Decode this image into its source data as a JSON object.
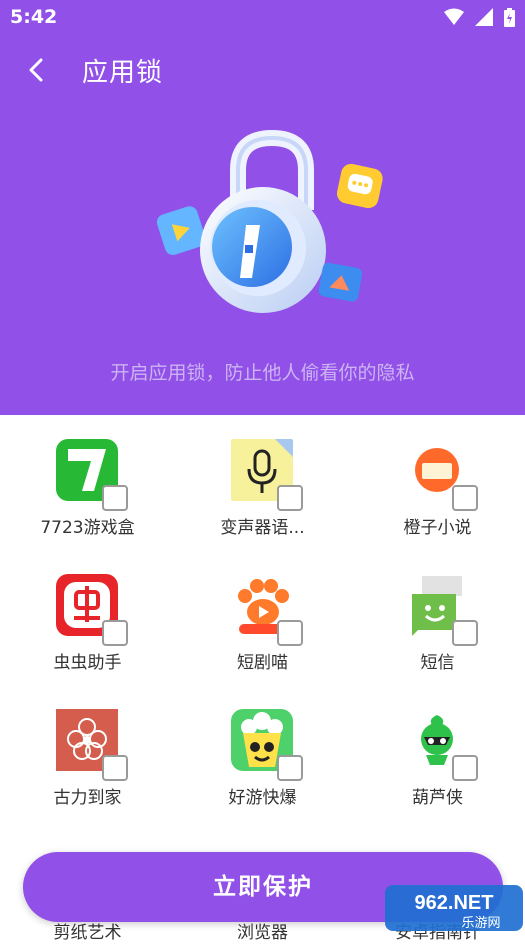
{
  "status_bar": {
    "time": "5:42"
  },
  "header": {
    "title": "应用锁"
  },
  "hero": {
    "subtitle": "开启应用锁，防止他人偷看你的隐私"
  },
  "apps": [
    {
      "name": "7723游戏盒"
    },
    {
      "name": "变声器语..."
    },
    {
      "name": "橙子小说"
    },
    {
      "name": "虫虫助手"
    },
    {
      "name": "短剧喵"
    },
    {
      "name": "短信"
    },
    {
      "name": "古力到家"
    },
    {
      "name": "好游快爆"
    },
    {
      "name": "葫芦侠"
    },
    {
      "name": "剪纸艺术"
    },
    {
      "name": "浏览器"
    },
    {
      "name": "安卓指南针"
    }
  ],
  "action": {
    "protect_label": "立即保护"
  },
  "watermark": {
    "brand": "962.NET",
    "sub": "乐游网"
  },
  "colors": {
    "primary": "#9150e8",
    "subtitle": "#cdb3f3"
  }
}
